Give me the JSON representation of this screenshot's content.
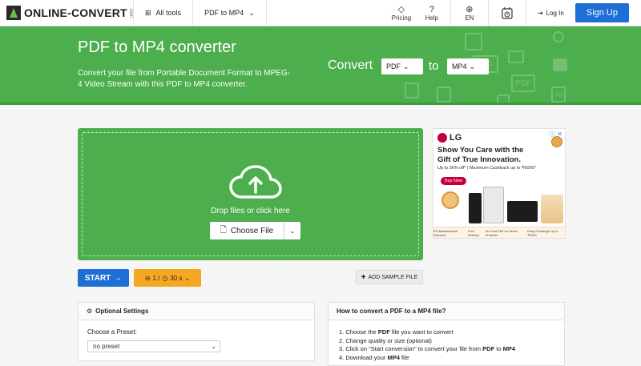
{
  "nav": {
    "logo_text": "ONLINE-CONVERT",
    "logo_suffix": ".com",
    "all_tools": "All tools",
    "converter_menu": "PDF to MP4",
    "pricing": "Pricing",
    "help": "Help",
    "language": "EN",
    "login": "Log In",
    "signup": "Sign Up"
  },
  "hero": {
    "title": "PDF to MP4 converter",
    "subtitle": "Convert your file from Portable Document Format to MPEG-4 Video Stream with this PDF to MP4 converter.",
    "convert_label": "Convert",
    "from_format": "PDF",
    "to_label": "to",
    "to_format": "MP4",
    "decor_labels": [
      "JPG",
      "PDF",
      "Ai"
    ]
  },
  "upload": {
    "drop_text": "Drop files or click here",
    "choose_file": "Choose File"
  },
  "ad": {
    "brand": "LG",
    "headline": "Show You Care with the Gift of True Innovation.",
    "offer": "Up to 36% off* | Maximum Cashback up to ₹6000*",
    "cta": "Buy Now",
    "footer_items": [
      "5% Mahamandal Discount",
      "Free Delivery",
      "No Cost EMI on Select Products",
      "Easy Exchange Up to ₹2000"
    ]
  },
  "actions": {
    "start": "START",
    "limit_files": "1 /",
    "limit_time": "30 s",
    "sample": "ADD SAMPLE FILE"
  },
  "optional": {
    "title": "Optional Settings",
    "preset_label": "Choose a Preset:",
    "preset_value": "no preset"
  },
  "howto": {
    "title": "How to convert a PDF to a MP4 file?",
    "steps": [
      {
        "pre": "1. Choose the ",
        "b": "PDF",
        "post": " file you want to convert",
        "b2": "",
        "post2": ""
      },
      {
        "pre": "2. Change quality or size (optional)",
        "b": "",
        "post": "",
        "b2": "",
        "post2": ""
      },
      {
        "pre": "3. Click on \"Start conversion\" to convert your file from ",
        "b": "PDF",
        "post": " to ",
        "b2": "MP4",
        "post2": ""
      },
      {
        "pre": "4. Download your ",
        "b": "MP4",
        "post": " file",
        "b2": "",
        "post2": ""
      }
    ]
  },
  "colors": {
    "brand_green": "#4cae4c",
    "primary_blue": "#1d6fd6",
    "limit_orange": "#f5a623"
  }
}
